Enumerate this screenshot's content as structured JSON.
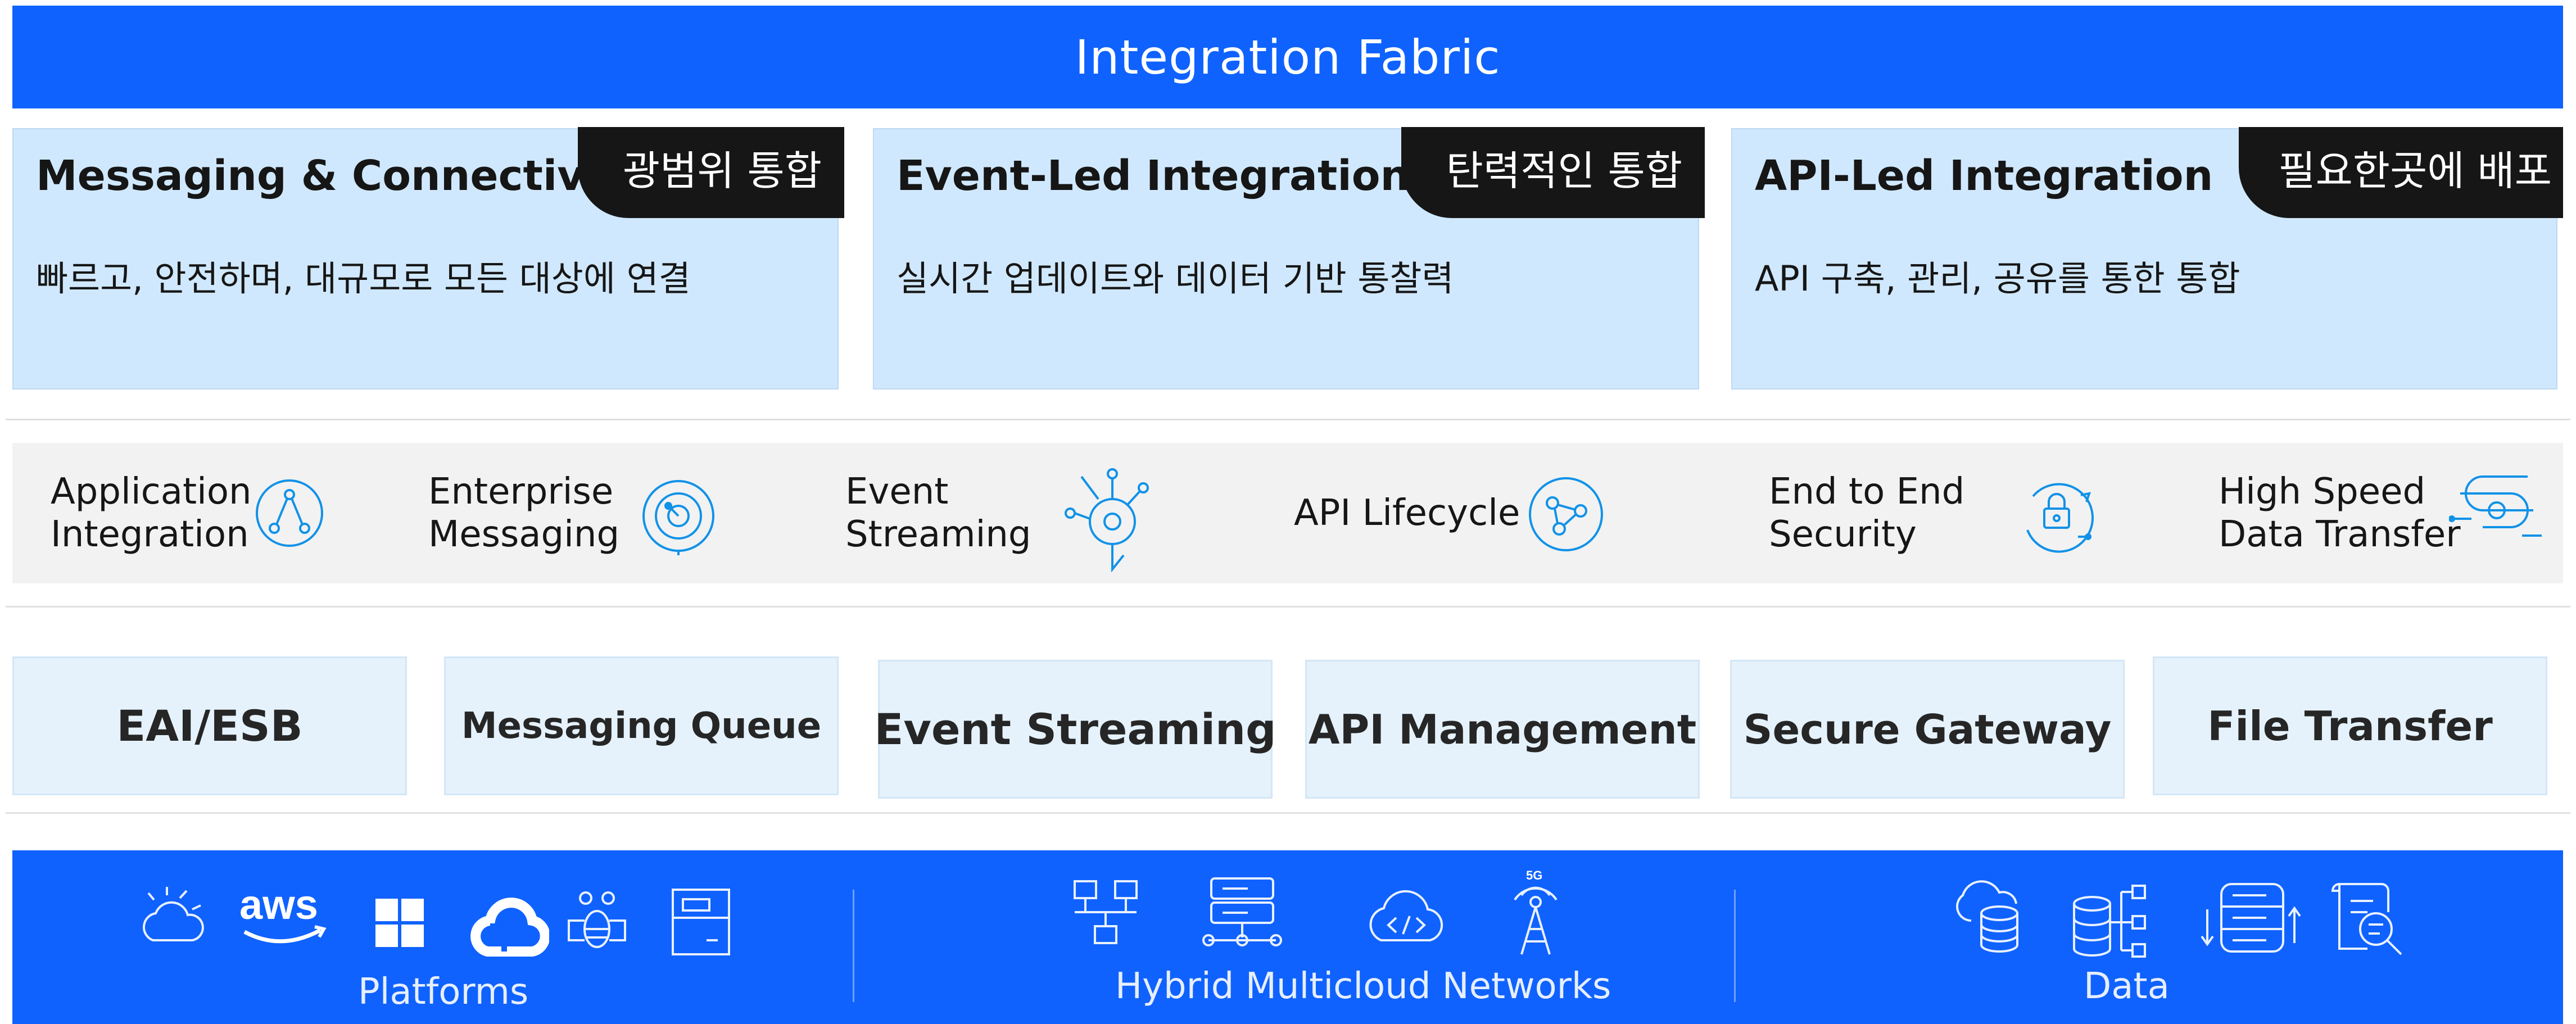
{
  "header": {
    "title": "Integration Fabric"
  },
  "cards": [
    {
      "title": "Messaging & Connectivity",
      "tag": "광범위 통합",
      "description": "빠르고, 안전하며, 대규모로 모든 대상에 연결"
    },
    {
      "title": "Event-Led Integration",
      "tag": "탄력적인 통합",
      "description": "실시간 업데이트와 데이터 기반 통찰력"
    },
    {
      "title": "API-Led Integration",
      "tag": "필요한곳에 배포",
      "description": "API 구축, 관리, 공유를 통한 통합"
    }
  ],
  "capabilities": [
    {
      "label": "Application\nIntegration",
      "icon": "application-integration-icon"
    },
    {
      "label": "Enterprise\nMessaging",
      "icon": "enterprise-messaging-icon"
    },
    {
      "label": "Event\nStreaming",
      "icon": "event-streaming-icon"
    },
    {
      "label": "API Lifecycle",
      "icon": "api-lifecycle-icon"
    },
    {
      "label": "End to End\nSecurity",
      "icon": "security-icon"
    },
    {
      "label": "High Speed\nData Transfer",
      "icon": "data-transfer-icon"
    }
  ],
  "products": [
    {
      "label": "EAI/ESB"
    },
    {
      "label": "Messaging Queue"
    },
    {
      "label": "Event Streaming"
    },
    {
      "label": "API Management"
    },
    {
      "label": "Secure Gateway"
    },
    {
      "label": "File Transfer"
    }
  ],
  "footer": {
    "platforms": {
      "label": "Platforms",
      "icons": [
        "private-cloud-icon",
        "aws-icon",
        "microsoft-windows-icon",
        "google-cloud-icon",
        "ibm-cloud-icon",
        "server-icon"
      ],
      "aws_text": "aws"
    },
    "networks": {
      "label": "Hybrid Multicloud Networks",
      "icons": [
        "network-topology-icon",
        "server-rack-network-icon",
        "cloud-code-icon",
        "5g-tower-icon"
      ],
      "fiveg_text": "5G"
    },
    "data": {
      "label": "Data",
      "icons": [
        "cloud-database-icon",
        "database-hierarchy-icon",
        "data-sync-icon",
        "document-search-icon"
      ]
    }
  },
  "colors": {
    "brand_blue": "#0f62fe",
    "card_fill": "#d0e8fd",
    "tag_fill": "#161616",
    "band_fill": "#f2f2f2",
    "product_fill": "#e5f2fc",
    "icon_stroke": "#1192e8"
  }
}
